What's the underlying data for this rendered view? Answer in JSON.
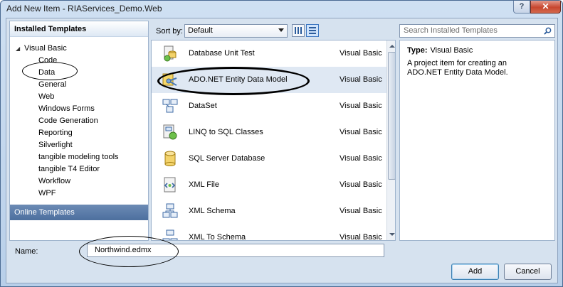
{
  "window": {
    "title": "Add New Item - RIAServices_Demo.Web",
    "help_label": "?",
    "close_label": "✕"
  },
  "left_pane": {
    "header": "Installed Templates",
    "root": {
      "label": "Visual Basic",
      "expanded": true
    },
    "items": [
      {
        "label": "Code"
      },
      {
        "label": "Data"
      },
      {
        "label": "General"
      },
      {
        "label": "Web"
      },
      {
        "label": "Windows Forms"
      },
      {
        "label": "Code Generation"
      },
      {
        "label": "Reporting"
      },
      {
        "label": "Silverlight"
      },
      {
        "label": "tangible modeling tools"
      },
      {
        "label": "tangible T4 Editor"
      },
      {
        "label": "Workflow"
      },
      {
        "label": "WPF"
      }
    ],
    "online_templates": "Online Templates"
  },
  "toolbar": {
    "sort_label": "Sort by:",
    "sort_value": "Default",
    "search_placeholder": "Search Installed Templates"
  },
  "templates": [
    {
      "name": "Database Unit Test",
      "lang": "Visual Basic",
      "icon": "database-unit-test-icon"
    },
    {
      "name": "ADO.NET Entity Data Model",
      "lang": "Visual Basic",
      "icon": "entity-model-icon"
    },
    {
      "name": "DataSet",
      "lang": "Visual Basic",
      "icon": "dataset-icon"
    },
    {
      "name": "LINQ to SQL Classes",
      "lang": "Visual Basic",
      "icon": "linq-icon"
    },
    {
      "name": "SQL Server Database",
      "lang": "Visual Basic",
      "icon": "database-icon"
    },
    {
      "name": "XML File",
      "lang": "Visual Basic",
      "icon": "xml-file-icon"
    },
    {
      "name": "XML Schema",
      "lang": "Visual Basic",
      "icon": "xml-schema-icon"
    },
    {
      "name": "XML To Schema",
      "lang": "Visual Basic",
      "icon": "xml-to-schema-icon"
    }
  ],
  "details": {
    "type_label": "Type:",
    "type_value": "Visual Basic",
    "description": "A project item for creating an ADO.NET Entity Data Model."
  },
  "name_field": {
    "label": "Name:",
    "value": "Northwind.edmx"
  },
  "buttons": {
    "add": "Add",
    "cancel": "Cancel"
  },
  "colors": {
    "accent": "#4d6f9e",
    "selection": "#dfe8f3",
    "dialog_bg": "#d6e2ef"
  }
}
